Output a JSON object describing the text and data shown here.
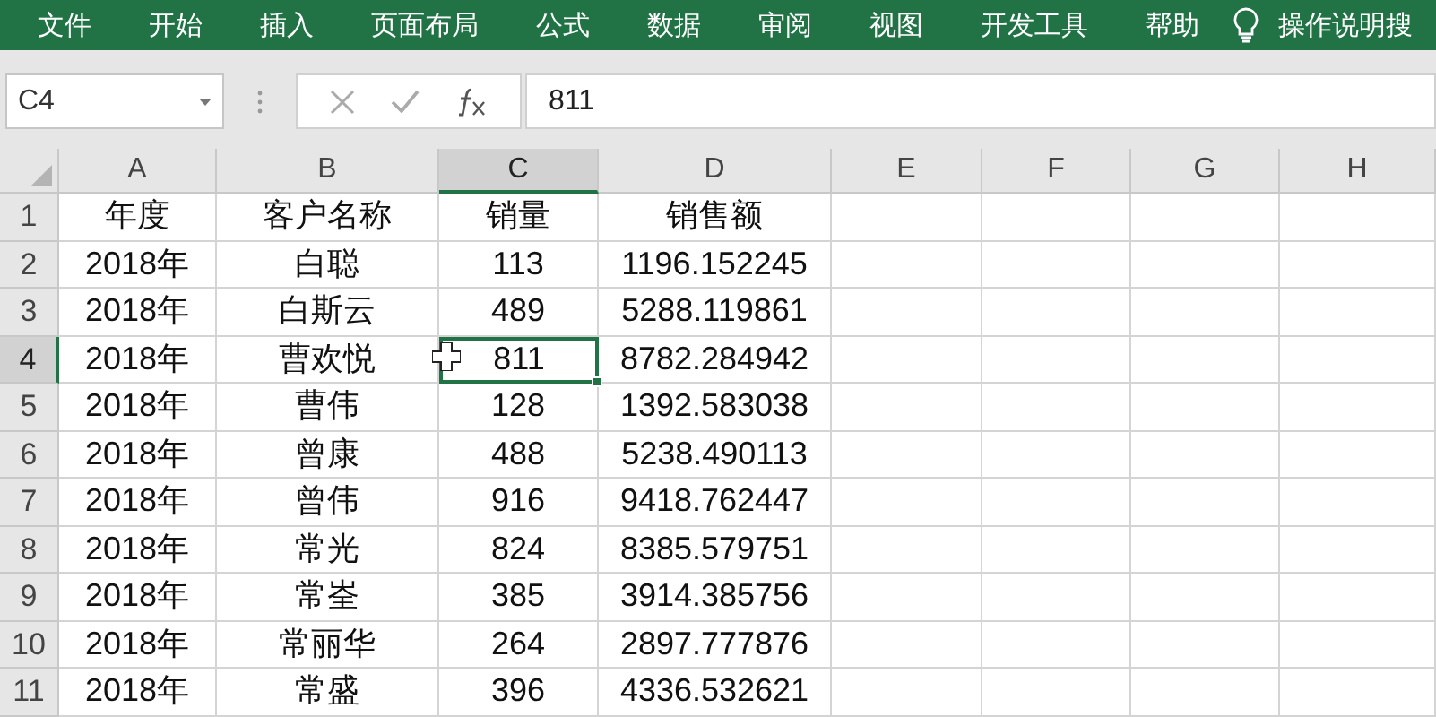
{
  "ribbon": {
    "tabs": [
      {
        "label": "文件"
      },
      {
        "label": "开始"
      },
      {
        "label": "插入"
      },
      {
        "label": "页面布局"
      },
      {
        "label": "公式"
      },
      {
        "label": "数据"
      },
      {
        "label": "审阅"
      },
      {
        "label": "视图"
      },
      {
        "label": "开发工具"
      },
      {
        "label": "帮助"
      }
    ],
    "search": "操作说明搜"
  },
  "formula_bar": {
    "name_box": "C4",
    "formula": "811"
  },
  "columns": [
    {
      "label": "A",
      "selected": false
    },
    {
      "label": "B",
      "selected": false
    },
    {
      "label": "C",
      "selected": true
    },
    {
      "label": "D",
      "selected": false
    },
    {
      "label": "E",
      "selected": false
    },
    {
      "label": "F",
      "selected": false
    },
    {
      "label": "G",
      "selected": false
    },
    {
      "label": "H",
      "selected": false
    }
  ],
  "rows": [
    {
      "number": "1",
      "selected": false,
      "cells": [
        "年度",
        "客户名称",
        "销量",
        "销售额"
      ]
    },
    {
      "number": "2",
      "selected": false,
      "cells": [
        "2018年",
        "白聪",
        "113",
        "1196.152245"
      ]
    },
    {
      "number": "3",
      "selected": false,
      "cells": [
        "2018年",
        "白斯云",
        "489",
        "5288.119861"
      ]
    },
    {
      "number": "4",
      "selected": true,
      "cells": [
        "2018年",
        "曹欢悦",
        "811",
        "8782.284942"
      ]
    },
    {
      "number": "5",
      "selected": false,
      "cells": [
        "2018年",
        "曹伟",
        "128",
        "1392.583038"
      ]
    },
    {
      "number": "6",
      "selected": false,
      "cells": [
        "2018年",
        "曾康",
        "488",
        "5238.490113"
      ]
    },
    {
      "number": "7",
      "selected": false,
      "cells": [
        "2018年",
        "曾伟",
        "916",
        "9418.762447"
      ]
    },
    {
      "number": "8",
      "selected": false,
      "cells": [
        "2018年",
        "常光",
        "824",
        "8385.579751"
      ]
    },
    {
      "number": "9",
      "selected": false,
      "cells": [
        "2018年",
        "常峑",
        "385",
        "3914.385756"
      ]
    },
    {
      "number": "10",
      "selected": false,
      "cells": [
        "2018年",
        "常丽华",
        "264",
        "2897.777876"
      ]
    },
    {
      "number": "11",
      "selected": false,
      "cells": [
        "2018年",
        "常盛",
        "396",
        "4336.532621"
      ]
    }
  ]
}
